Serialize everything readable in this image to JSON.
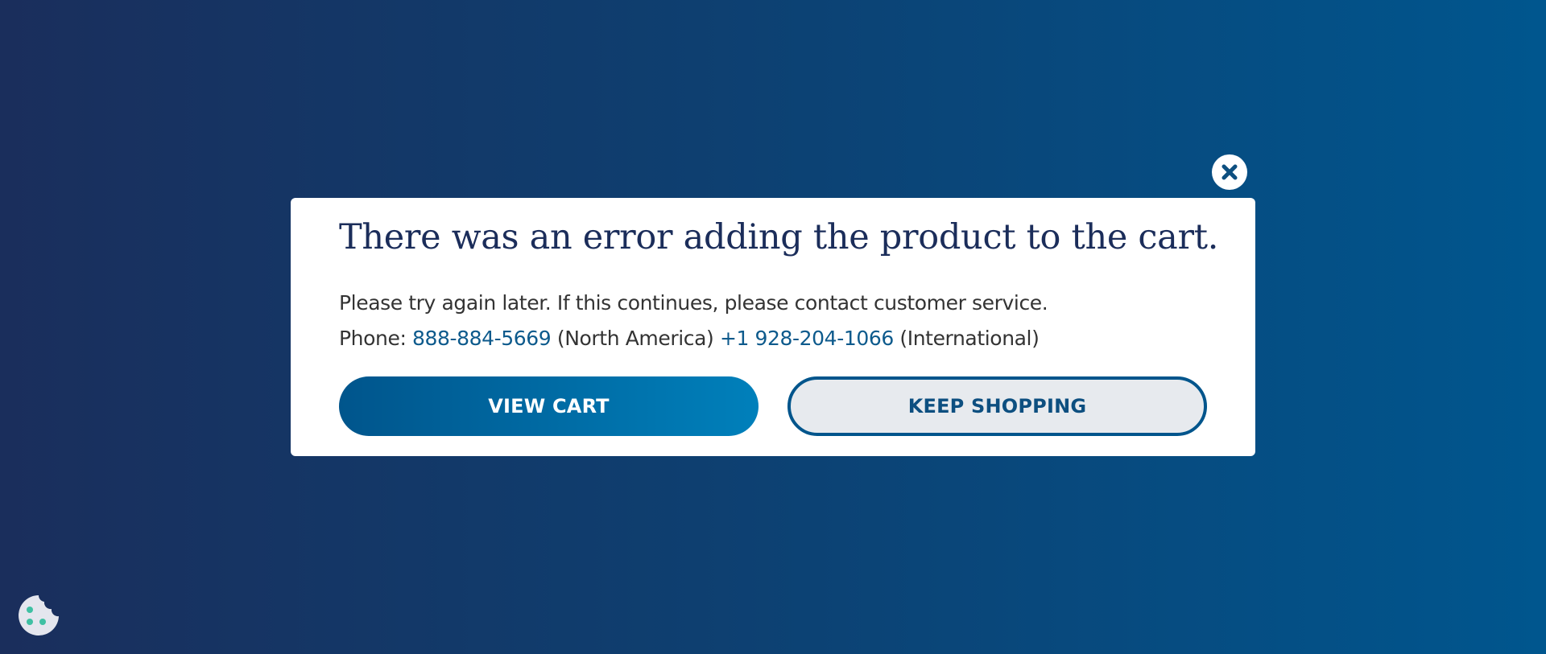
{
  "modal": {
    "title": "There was an error adding the product to the cart.",
    "message": "Please try again later. If this continues, please contact customer service.",
    "phone_label": "Phone:",
    "phone_na": "888-884-5669",
    "phone_na_region": "(North America)",
    "phone_intl": "+1 928-204-1066",
    "phone_intl_region": "(International)",
    "view_cart_label": "VIEW CART",
    "keep_shopping_label": "KEEP SHOPPING"
  },
  "icons": {
    "close": "close-icon",
    "cookie": "cookie-icon"
  },
  "colors": {
    "background_start": "#1a2e5c",
    "background_end": "#00568e",
    "title": "#1b2d5a",
    "link": "#0d5a8c",
    "primary_button": "#00558c",
    "secondary_button_bg": "#e7eaee",
    "cookie_dots": "#3fc0a3"
  }
}
